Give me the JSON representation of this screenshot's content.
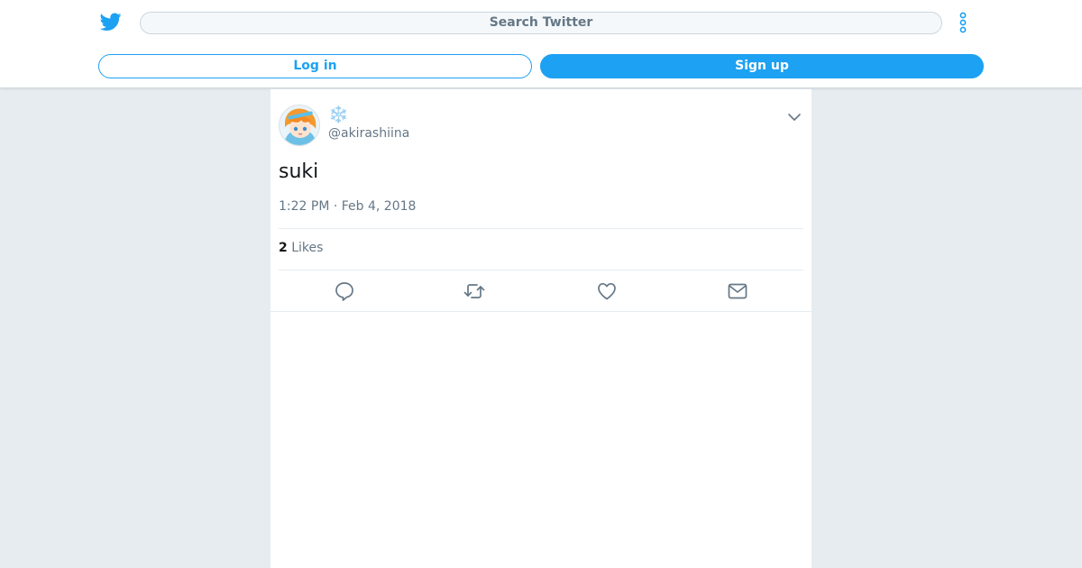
{
  "header": {
    "search_placeholder": "Search Twitter",
    "login_label": "Log in",
    "signup_label": "Sign up",
    "logo_icon": "twitter-bird-icon",
    "more_icon": "more-vertical-icon",
    "accent_color": "#1da1f2"
  },
  "tweet": {
    "display_name": "❄️",
    "handle": "@akirashiina",
    "text": "suki",
    "timestamp": "1:22 PM · Feb 4, 2018",
    "likes_count": "2",
    "likes_label": "Likes",
    "actions": [
      "reply-icon",
      "retweet-icon",
      "like-icon",
      "share-icon"
    ]
  }
}
